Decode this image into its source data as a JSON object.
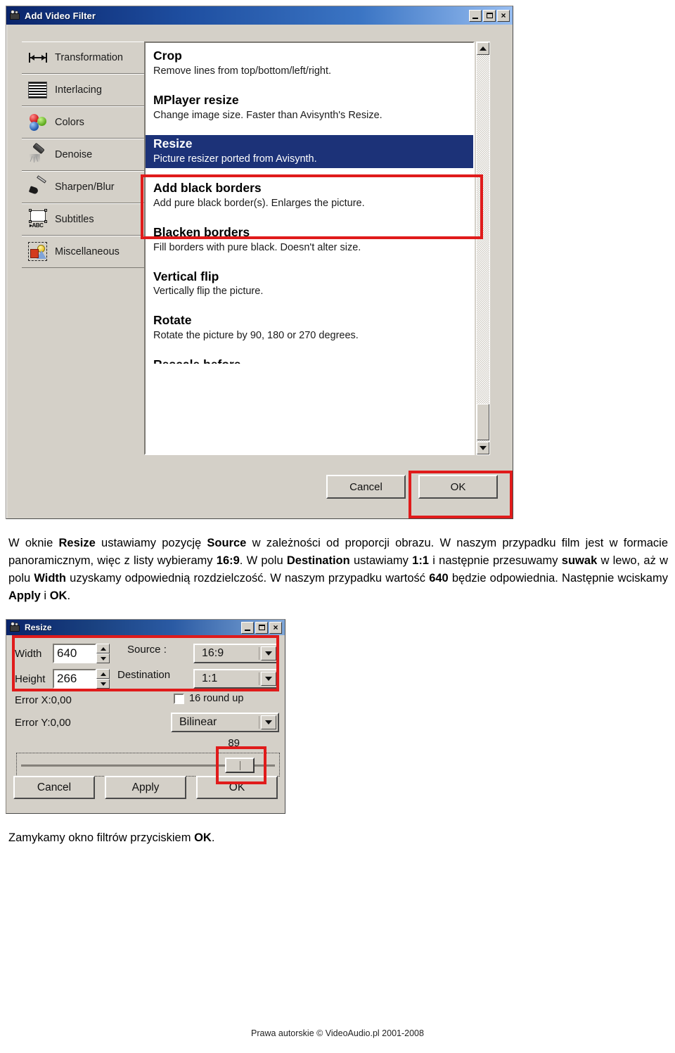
{
  "add_video_filter": {
    "title": "Add Video Filter",
    "window_controls": {
      "minimize": "_",
      "maximize": "□",
      "close": "×"
    },
    "categories": [
      {
        "label": "Transformation",
        "icon": "resize-arrows-icon"
      },
      {
        "label": "Interlacing",
        "icon": "stripes-icon"
      },
      {
        "label": "Colors",
        "icon": "color-spheres-icon"
      },
      {
        "label": "Denoise",
        "icon": "spray-tool-icon"
      },
      {
        "label": "Sharpen/Blur",
        "icon": "paintbrush-icon"
      },
      {
        "label": "Subtitles",
        "icon": "subtitle-frame-icon"
      },
      {
        "label": "Miscellaneous",
        "icon": "shapes-selection-icon"
      }
    ],
    "filters": [
      {
        "name": "Crop",
        "desc": "Remove lines from top/bottom/left/right.",
        "selected": false
      },
      {
        "name": "MPlayer resize",
        "desc": "Change image size. Faster than Avisynth's Resize.",
        "selected": false
      },
      {
        "name": "Resize",
        "desc": "Picture resizer ported from Avisynth.",
        "selected": true
      },
      {
        "name": "Add black borders",
        "desc": "Add pure black border(s). Enlarges the picture.",
        "selected": false
      },
      {
        "name": "Blacken borders",
        "desc": "Fill borders with pure black. Doesn't alter size.",
        "selected": false
      },
      {
        "name": "Vertical flip",
        "desc": "Vertically flip the picture.",
        "selected": false
      },
      {
        "name": "Rotate",
        "desc": "Rotate the picture by 90, 180 or 270 degrees.",
        "selected": false
      }
    ],
    "partial_filter": "Rescale before",
    "buttons": {
      "cancel": "Cancel",
      "ok": "OK"
    },
    "highlight_color": "#e01b1b",
    "selection_color": "#1c3278"
  },
  "paragraph": {
    "t1": "W oknie ",
    "b1": "Resize",
    "t2": " ustawiamy pozycję ",
    "b2": "Source",
    "t3": " w zależności od proporcji obrazu. W naszym przypadku film jest w formacie panoramicznym, więc z listy wybieramy ",
    "b3": "16:9",
    "t4": ". W polu ",
    "b4": "Destination",
    "t5": " ustawiamy ",
    "b5": "1:1",
    "t6": " i następnie przesuwamy ",
    "b6": "suwak",
    "t7": " w lewo, aż w polu ",
    "b7": "Width",
    "t8": " uzyskamy odpowiednią rozdzielczość. W naszym przypadku wartość ",
    "b8": "640",
    "t9": " będzie odpowiednia. Następnie wciskamy ",
    "b9": "Apply",
    "t10": " i ",
    "b10": "OK",
    "t11": "."
  },
  "resize_dialog": {
    "title": "Resize",
    "width_label": "Width",
    "width_value": "640",
    "height_label": "Height",
    "height_value": "266",
    "source_label": "Source :",
    "source_value": "16:9",
    "destination_label": "Destination",
    "destination_value": "1:1",
    "error_x": "Error X:0,00",
    "error_y": "Error Y:0,00",
    "round_up_label": "16 round up",
    "round_up_checked": false,
    "filter_method": "Bilinear",
    "slider_value": "89",
    "slider_percent": 79,
    "buttons": {
      "cancel": "Cancel",
      "apply": "Apply",
      "ok": "OK"
    }
  },
  "closing": {
    "t1": "Zamykamy okno filtrów przyciskiem ",
    "b1": "OK",
    "t2": "."
  },
  "footer": {
    "text": "Prawa autorskie © VideoAudio.pl 2001-2008"
  }
}
